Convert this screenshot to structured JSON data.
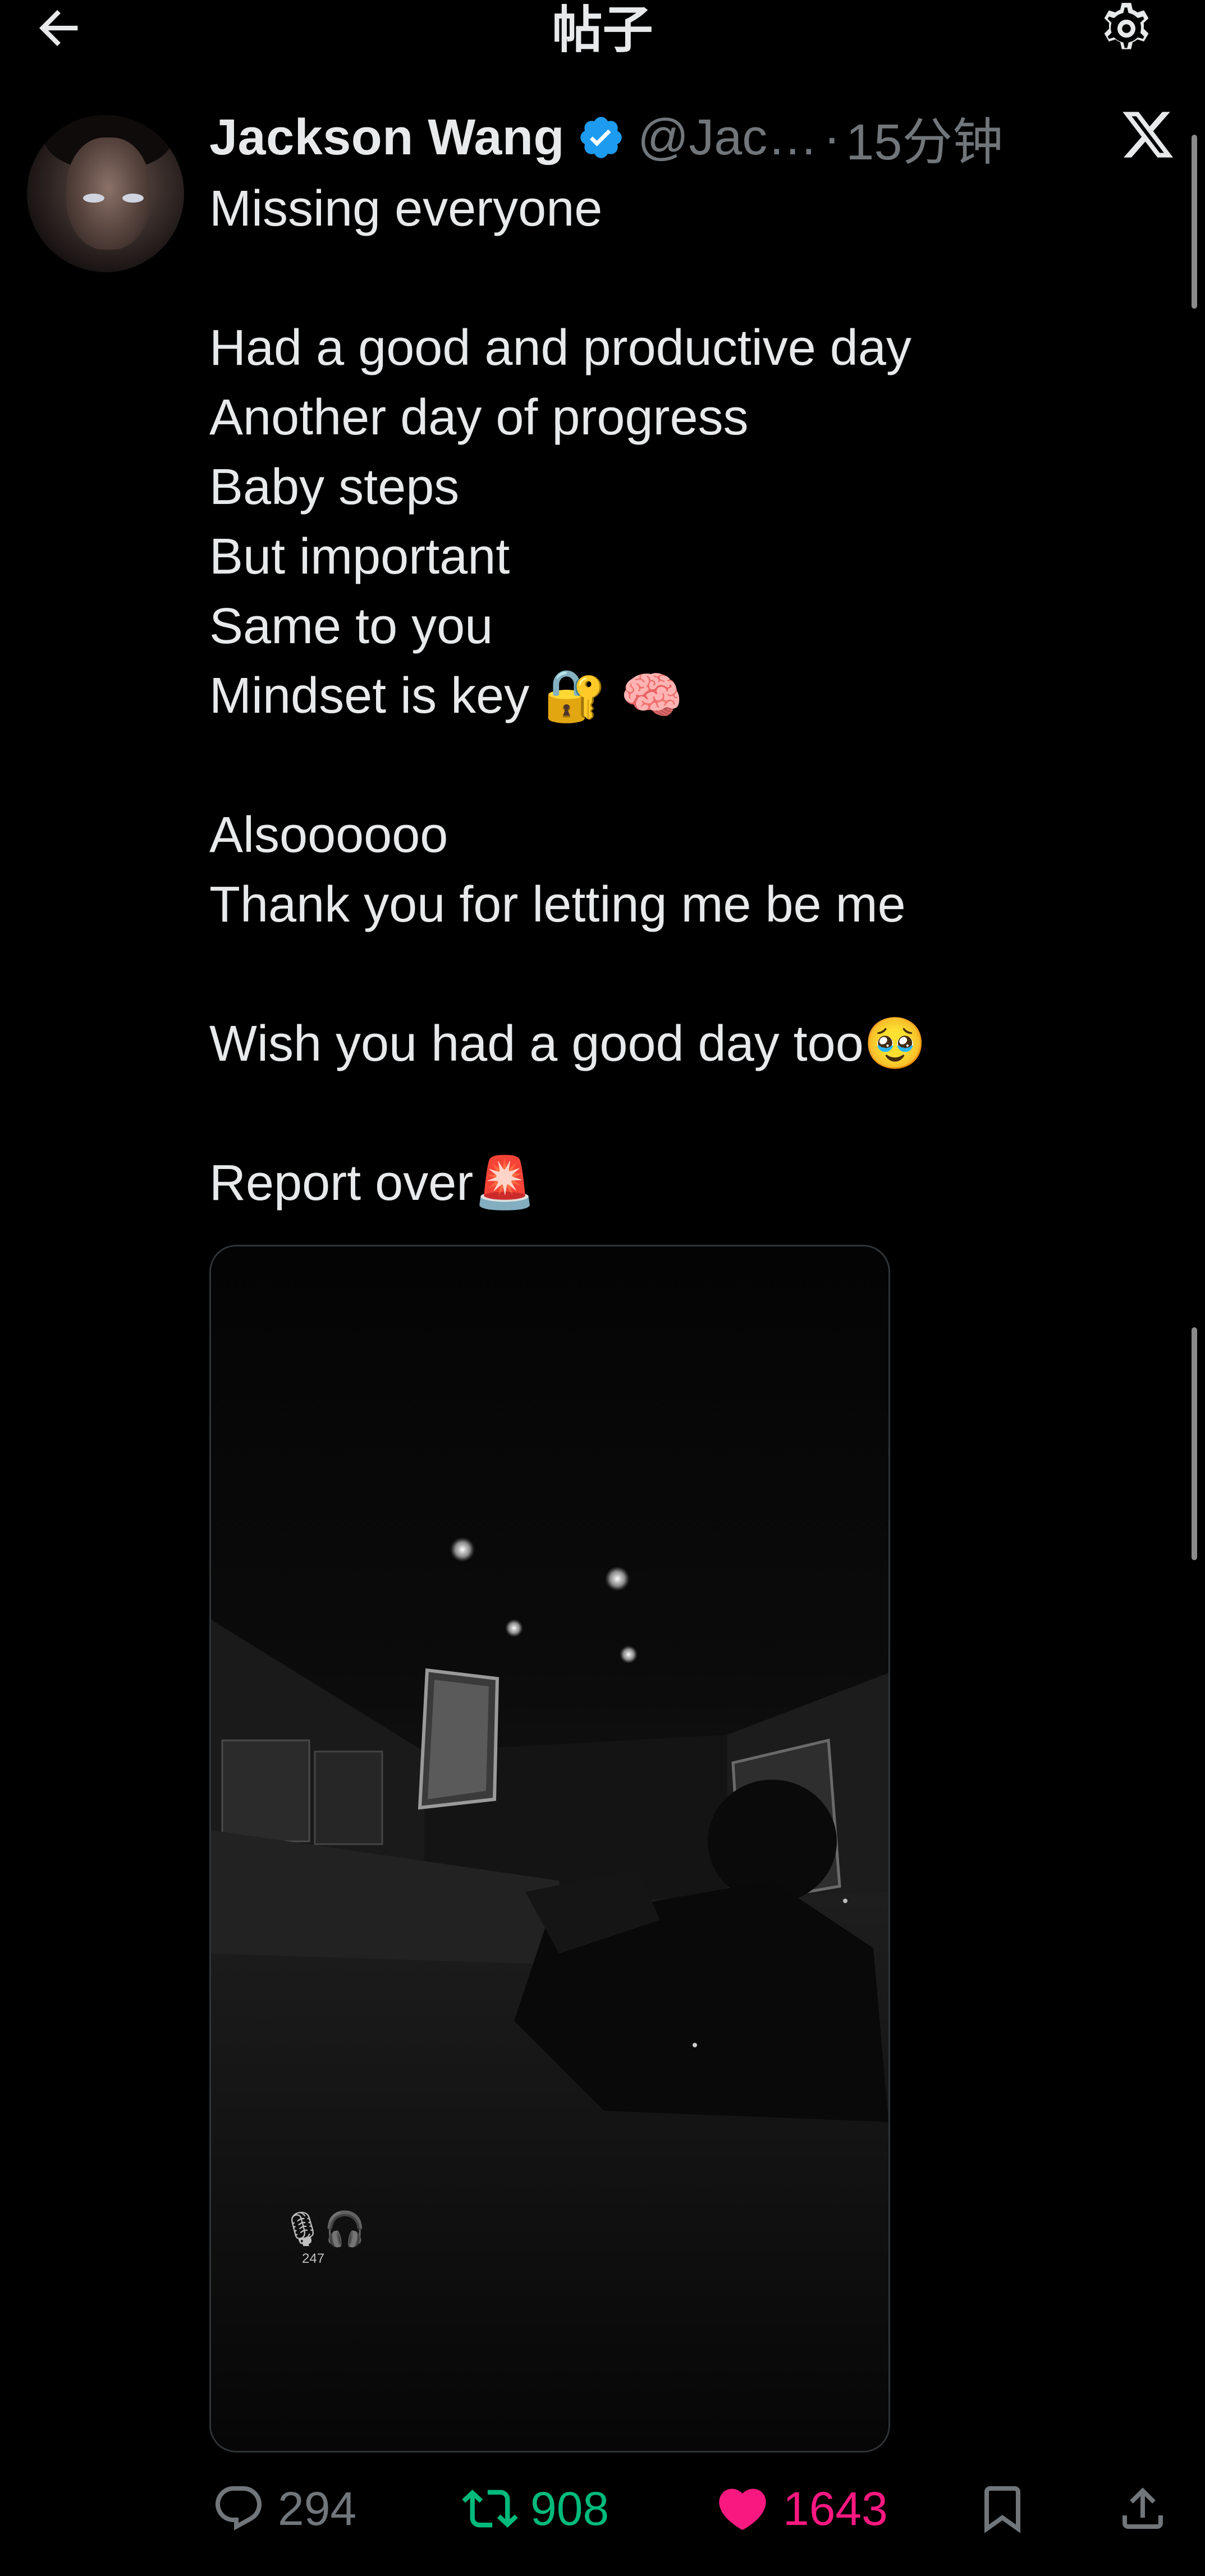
{
  "header": {
    "title": "帖子",
    "back_icon": "arrow-left-icon",
    "settings_icon": "gear-icon"
  },
  "post": {
    "author_name": "Jackson Wang",
    "author_handle": "@Jac…",
    "separator": "·",
    "time": "15分钟",
    "verified": true,
    "platform_icon": "x-logo-icon",
    "lines": [
      "Missing everyone",
      "",
      "Had a good and productive day",
      "Another day of progress",
      "Baby steps",
      "But important",
      "Same to you",
      "Mindset is key 🔐 🧠",
      "",
      "Alsoooooo",
      "Thank you for letting me be me",
      "",
      "Wish you had a good day too🥹",
      "",
      "Report over🚨"
    ],
    "media": {
      "caption_icons": "🎙🎧",
      "caption_number": "247"
    }
  },
  "actions": {
    "replies": "294",
    "reposts": "908",
    "likes": "1643",
    "reply_icon": "speech-bubble-icon",
    "repost_icon": "repost-icon",
    "like_icon": "heart-icon",
    "bookmark_icon": "bookmark-icon",
    "share_icon": "share-icon"
  },
  "colors": {
    "background": "#000000",
    "text": "#e7e9ea",
    "muted": "#71767b",
    "verified": "#1d9bf0",
    "repost_active": "#00ba7c",
    "like_active": "#f91880"
  }
}
